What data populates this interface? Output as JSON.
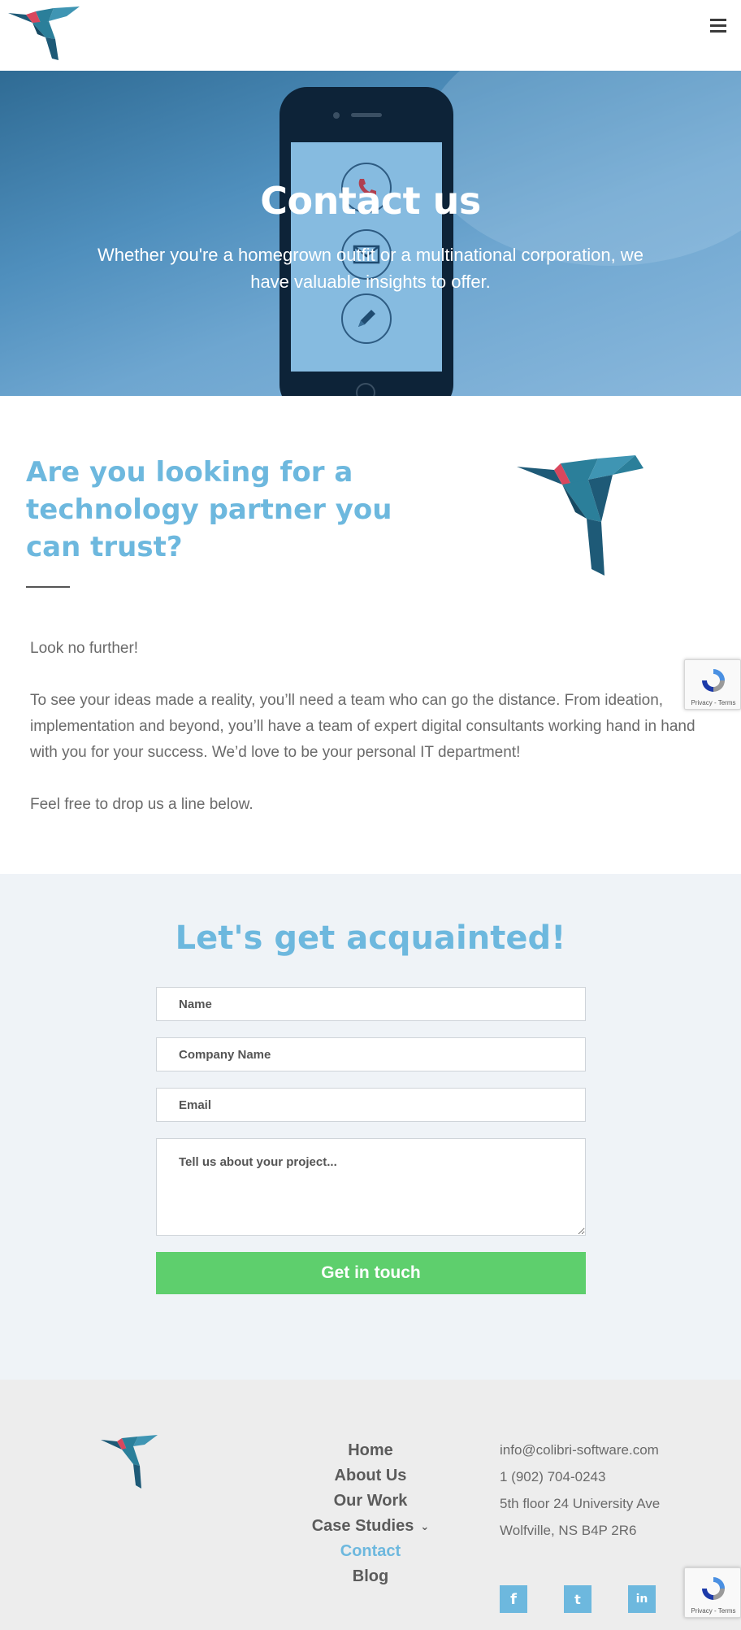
{
  "header": {
    "logo_name": "colibri-hummingbird-logo",
    "menu_icon": "hamburger-menu-icon"
  },
  "hero": {
    "title": "Contact us",
    "subtitle": "Whether you're a homegrown outfit or a multinational corporation, we have valuable insights to offer.",
    "phone_icons": [
      "phone-icon",
      "envelope-icon",
      "pencil-icon"
    ]
  },
  "intro": {
    "heading": "Are you looking for a technology partner you can trust?",
    "paragraphs": [
      "Look no further!",
      "To see your ideas made a reality, you’ll need a team who can go the distance. From ideation, implementation and beyond, you’ll have a team of expert digital consultants working hand in hand with you for your success. We’d love to be your personal IT department!",
      "Feel free to drop us a line below."
    ]
  },
  "recaptcha": {
    "terms": "Privacy - Terms"
  },
  "form": {
    "title": "Let's get acquainted!",
    "name_placeholder": "Name",
    "company_placeholder": "Company Name",
    "email_placeholder": "Email",
    "message_placeholder": "Tell us about your project...",
    "submit_label": "Get in touch"
  },
  "footer": {
    "nav": [
      {
        "label": "Home"
      },
      {
        "label": "About Us"
      },
      {
        "label": "Our Work"
      },
      {
        "label": "Case Studies"
      },
      {
        "label": "Contact"
      },
      {
        "label": "Blog"
      }
    ],
    "contact": {
      "email": "info@colibri-software.com",
      "phone": "1 (902) 704-0243",
      "address_line1": "5th floor 24 University Ave",
      "address_line2": "Wolfville, NS B4P 2R6"
    },
    "social": [
      {
        "icon": "facebook-icon",
        "glyph": "f"
      },
      {
        "icon": "twitter-icon",
        "glyph": "t"
      },
      {
        "icon": "linkedin-icon",
        "glyph": "in"
      }
    ]
  },
  "colors": {
    "accent_blue": "#6db8de",
    "button_green": "#5ecf6d",
    "bird_teal": "#2b7f9a",
    "bird_red": "#d9475d"
  }
}
